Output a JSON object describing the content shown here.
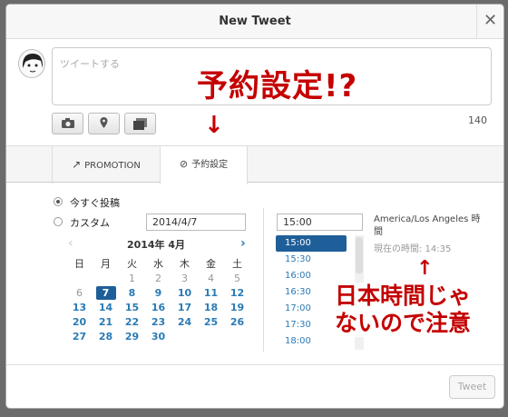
{
  "dialog": {
    "title": "New Tweet",
    "close_symbol": "✕"
  },
  "compose": {
    "placeholder": "ツイートする",
    "counter": "140"
  },
  "tabs": [
    {
      "label": "PROMOTION",
      "icon": "arrow-up-right-icon"
    },
    {
      "label": "予約設定",
      "icon": "clock-icon"
    }
  ],
  "schedule": {
    "option_now": "今すぐ投稿",
    "option_custom": "カスタム",
    "date_value": "2014/4/7",
    "time_value": "15:00",
    "timezone": "America/Los Angeles 時間",
    "current_time": "現在の時間: 14:35"
  },
  "calendar": {
    "month_label": "2014年 4月",
    "weekdays": [
      "日",
      "月",
      "火",
      "水",
      "木",
      "金",
      "土"
    ],
    "rows": [
      [
        "",
        "",
        "1",
        "2",
        "3",
        "4",
        "5"
      ],
      [
        "6",
        "7",
        "8",
        "9",
        "10",
        "11",
        "12"
      ],
      [
        "13",
        "14",
        "15",
        "16",
        "17",
        "18",
        "19"
      ],
      [
        "20",
        "21",
        "22",
        "23",
        "24",
        "25",
        "26"
      ],
      [
        "27",
        "28",
        "29",
        "30",
        "",
        "",
        ""
      ]
    ],
    "selected_day": "7"
  },
  "times": [
    "15:00",
    "15:30",
    "16:00",
    "16:30",
    "17:00",
    "17:30",
    "18:00"
  ],
  "annotations": {
    "top": "予約設定!?",
    "arrow_down": "↓",
    "arrow_up": "↑",
    "bottom_line1": "日本時間じゃ",
    "bottom_line2": "ないので注意"
  },
  "footer": {
    "tweet_label": "Tweet"
  },
  "colors": {
    "accent": "#1f5f99",
    "link": "#2a7ab5",
    "annotation": "#c40000"
  }
}
